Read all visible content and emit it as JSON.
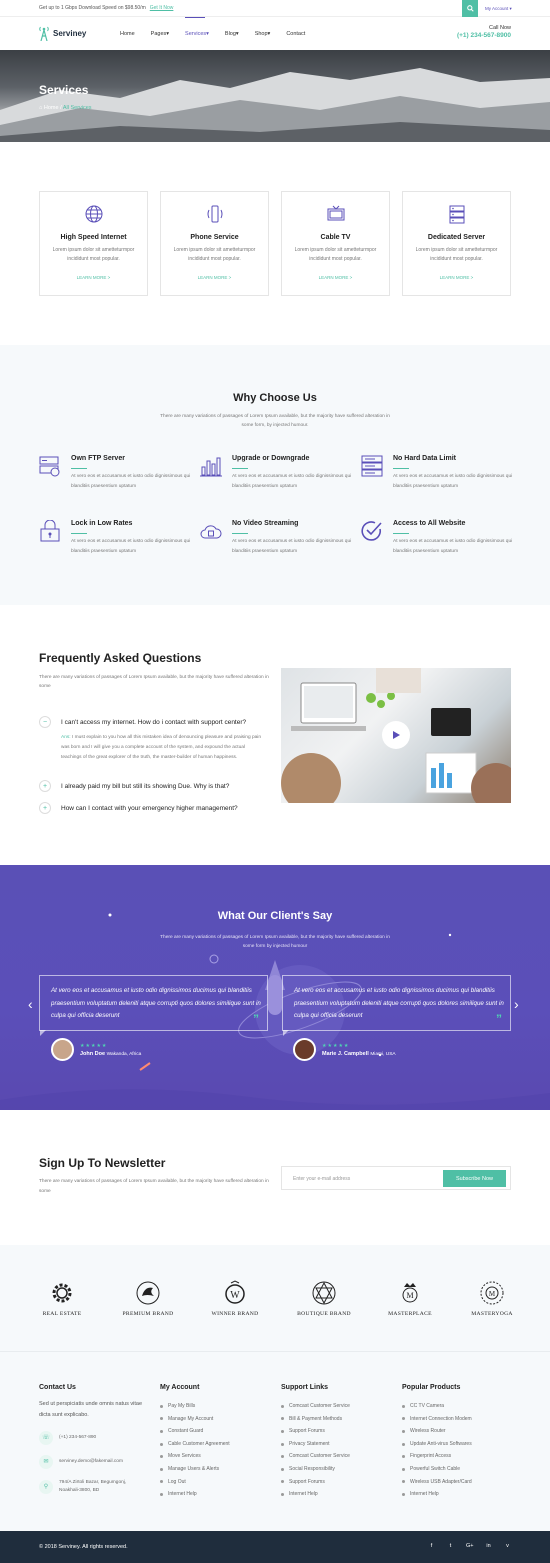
{
  "topbar": {
    "promo": "Get up to 1 Gbps Download Speed on $98.50/m",
    "promo_link": "Get It Now",
    "account": "My Account"
  },
  "nav": {
    "brand": "Serviney",
    "menu": [
      "Home",
      "Pages",
      "Services",
      "Blog",
      "Shop",
      "Contact"
    ],
    "call_label": "Call Now",
    "phone": "(+1) 234-567-8900"
  },
  "hero": {
    "title": "Services",
    "crumb_home": "Home",
    "crumb_sep": "/",
    "crumb_current": "All Services"
  },
  "services": [
    {
      "icon": "globe-icon",
      "title": "High Speed Internet",
      "text": "Lorem ipsum dolor sit ametteturmpor incididunt most popular.",
      "more": "LEARN MORE >"
    },
    {
      "icon": "phone-icon",
      "title": "Phone Service",
      "text": "Lorem ipsum dolor sit ametteturmpor incididunt most popular.",
      "more": "LEARN MORE >"
    },
    {
      "icon": "tv-icon",
      "title": "Cable TV",
      "text": "Lorem ipsum dolor sit ametteturmpor incididunt most popular.",
      "more": "LEARN MORE >"
    },
    {
      "icon": "server-icon",
      "title": "Dedicated Server",
      "text": "Lorem ipsum dolor sit ametteturmpor incididunt most popular.",
      "more": "LEARN MORE >"
    }
  ],
  "why": {
    "title": "Why Choose Us",
    "subtitle": "There are many variations of passages of Lorem Ipsum available, but the majority have suffered alteration in some form, by injected humour.",
    "features": [
      {
        "icon": "ftp-server-icon",
        "title": "Own FTP Server",
        "text": "At vero eos et accusamus et iusto odio dignissimous qui blanditiis praesentium uptatum"
      },
      {
        "icon": "bar-chart-icon",
        "title": "Upgrade or Downgrade",
        "text": "At vero eos et accusamus et iusto odio dignissimous qui blanditiis praesentium uptatum"
      },
      {
        "icon": "data-server-icon",
        "title": "No Hard Data Limit",
        "text": "At vero eos et accusamus et iusto odio dignissimous qui blanditiis praesentium uptatum"
      },
      {
        "icon": "lock-icon",
        "title": "Lock in Low Rates",
        "text": "At vero eos et accusamus et iusto odio dignissimous qui blanditiis praesentium uptatum"
      },
      {
        "icon": "cloud-icon",
        "title": "No Video Streaming",
        "text": "At vero eos et accusamus et iusto odio dignissimous qui blanditiis praesentium uptatum"
      },
      {
        "icon": "check-circle-icon",
        "title": "Access to All Website",
        "text": "At vero eos et accusamus et iusto odio dignissimous qui blanditiis praesentium uptatum"
      }
    ]
  },
  "faq": {
    "title": "Frequently Asked Questions",
    "subtitle": "There are many variations of passages of Lorem Ipsum available, but the majority have suffered alteration in some",
    "questions": [
      {
        "q": "I can't access my internet. How do i contact with support center?",
        "toggle": "−"
      },
      {
        "q": "I already paid my bill but still its showing Due. Why is that?",
        "toggle": "+"
      },
      {
        "q": "How can I contact with your emergency higher management?",
        "toggle": "+"
      }
    ],
    "answer_label": "Ans:",
    "answer": "I must explain to you how all this mistaken idea of denouncing pleasure and praising pain was born and I will give you a complete account of the system, and expound the actual teachings of the great explorer of the truth, the master-builder of human happiness."
  },
  "testimonials": {
    "title": "What Our Client's Say",
    "subtitle": "There are many variations of passages of Lorem Ipsum available, but the majority have suffered alteration in some form by injected humour",
    "items": [
      {
        "quote": "At vero eos et accusamus et iusto odio dignissimos ducimus qui blanditiis praesentium voluptatum deleniti atque corrupti quos dolores similique sunt in culpa qui officia deserunt",
        "name": "John Doe",
        "location": "Wakanda, Africa",
        "stars": "★★★★★"
      },
      {
        "quote": "At vero eos et accusamus et iusto odio dignissimos ducimus qui blanditiis praesentium voluptatum deleniti atque corrupti quos dolores similique sunt in culpa qui officia deserunt",
        "name": "Marie J. Campbell",
        "location": "Miami, USA",
        "stars": "★★★★★"
      }
    ],
    "quote_mark": "”"
  },
  "newsletter": {
    "title": "Sign Up To Newsletter",
    "subtitle": "There are many variations of passages of Lorem Ipsum available, but the majority have suffered alteration in some",
    "placeholder": "Enter your e-mail address",
    "button": "Subscribe Now"
  },
  "brands": [
    {
      "icon": "gear-logo-icon",
      "name": "REAL ESTATE"
    },
    {
      "icon": "dragon-logo-icon",
      "name": "PREMIUM BRAND"
    },
    {
      "icon": "crest-logo-icon",
      "name": "WINNER BRAND"
    },
    {
      "icon": "star-emblem-logo-icon",
      "name": "BOUTIQUE BRAND"
    },
    {
      "icon": "crown-m-logo-icon",
      "name": "MASTERPLACE"
    },
    {
      "icon": "ornament-m-logo-icon",
      "name": "MASTERYOGA"
    }
  ],
  "footer": {
    "contact": {
      "title": "Contact Us",
      "text": "Sed ut perspiciatis unde omnis natus vitae dicta sunt explicabo.",
      "phone": "(+1) 234-567-890",
      "email": "serviney.demo@fakemail.com",
      "address": "794/A Zirtoli Bazar, Begumgonj, Noakhali-3800, BD"
    },
    "account": {
      "title": "My Account",
      "items": [
        "Pay My Bills",
        "Manage My Account",
        "Constant Guard",
        "Cable Customer Agreement",
        "Move Services",
        "Manage Users & Alerts",
        "Log Out",
        "Internet Help"
      ]
    },
    "support": {
      "title": "Support Links",
      "items": [
        "Comcast Customer Service",
        "Bill & Payment Methods",
        "Support Forums",
        "Privacy Statement",
        "Comcast Customer Service",
        "Social Responsibility",
        "Support Forums",
        "Internet Help"
      ]
    },
    "products": {
      "title": "Popular Products",
      "items": [
        "CC TV Camera",
        "Internet Connection Modem",
        "Wireless Router",
        "Update Anti-virus Softwares",
        "Fingerprint Access",
        "Powerful Switch Cable",
        "Wireless USB Adapter/Card",
        "Internet Help"
      ]
    },
    "copyright": "© 2018 Serviney. All rights reserved.",
    "social": [
      "f",
      "t",
      "G+",
      "in",
      "v"
    ]
  },
  "colors": {
    "accent": "#4fbfa5",
    "purple": "#5a4fb8",
    "dark": "#1f2d3d"
  }
}
